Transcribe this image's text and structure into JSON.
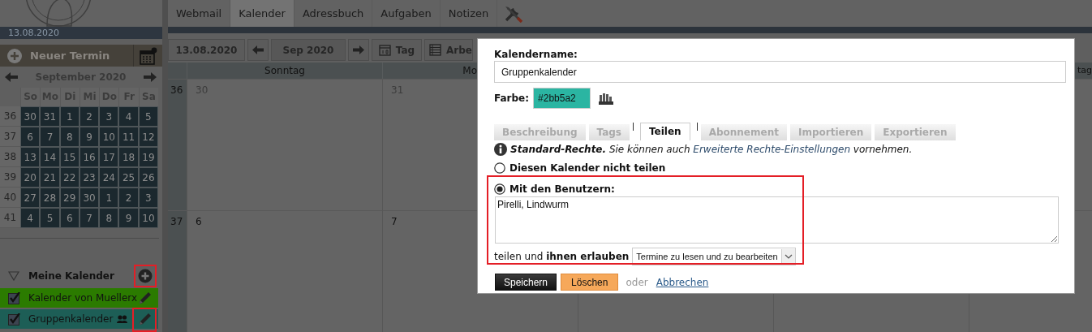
{
  "top_nav": {
    "tabs": [
      {
        "label": "Webmail",
        "selected": false
      },
      {
        "label": "Kalender",
        "selected": true
      },
      {
        "label": "Adressbuch",
        "selected": false
      },
      {
        "label": "Aufgaben",
        "selected": false
      },
      {
        "label": "Notizen",
        "selected": false
      }
    ]
  },
  "sidebar": {
    "date": "13.08.2020",
    "new_event": "Neuer Termin",
    "mini_calendar": {
      "title": "September 2020",
      "weekdays": [
        "So",
        "Mo",
        "Di",
        "Mi",
        "Do",
        "Fr",
        "Sa"
      ],
      "weeks": [
        {
          "number": "36",
          "days": [
            "30",
            "31",
            "1",
            "2",
            "3",
            "4",
            "5"
          ]
        },
        {
          "number": "37",
          "days": [
            "6",
            "7",
            "8",
            "9",
            "10",
            "11",
            "12"
          ]
        },
        {
          "number": "38",
          "days": [
            "13",
            "14",
            "15",
            "16",
            "17",
            "18",
            "19"
          ]
        },
        {
          "number": "39",
          "days": [
            "20",
            "21",
            "22",
            "23",
            "24",
            "25",
            "26"
          ]
        },
        {
          "number": "40",
          "days": [
            "27",
            "28",
            "29",
            "30",
            "1",
            "2",
            "3"
          ]
        },
        {
          "number": "41",
          "days": [
            "4",
            "5",
            "6",
            "7",
            "8",
            "9",
            "10"
          ]
        }
      ]
    },
    "my_calendars": {
      "title": "Meine Kalender",
      "expanded": true,
      "add_highlighted": true,
      "items": [
        {
          "name": "Kalender von Muellerx",
          "checked": true,
          "color": "#2b7b00",
          "shared": false,
          "highlighted": false
        },
        {
          "name": "Gruppenkalender",
          "checked": true,
          "color": "#1d5e56",
          "shared": true,
          "highlighted": true
        }
      ]
    }
  },
  "toolbar": {
    "date": "13.08.2020",
    "period": "Sep 2020",
    "views": [
      "Tag",
      "Arbe"
    ]
  },
  "calendar": {
    "day_columns": [
      {
        "label": "Sonntag"
      },
      {
        "label": "Mo"
      },
      {},
      {},
      {
        "label": "tag"
      }
    ],
    "weeks": [
      {
        "number": "36",
        "days": [
          {
            "label": "30",
            "muted": true
          },
          {
            "label": "31",
            "muted": true
          }
        ]
      },
      {
        "number": "37",
        "days": [
          {
            "label": "6",
            "muted": false
          },
          {
            "label": "7",
            "muted": false
          }
        ]
      }
    ]
  },
  "dialog": {
    "name_label": "Kalendername:",
    "name_value": "Gruppenkalender",
    "color_label": "Farbe:",
    "color_value": "#2bb5a2",
    "tabs": [
      {
        "label": "Beschreibung",
        "selected": false
      },
      {
        "label": "Tags",
        "selected": false
      },
      {
        "label": "Teilen",
        "selected": true
      },
      {
        "label": "Abonnement",
        "selected": false
      },
      {
        "label": "Importieren",
        "selected": false
      },
      {
        "label": "Exportieren",
        "selected": false
      }
    ],
    "info": {
      "before": "**Standard-Rechte.** Sie können auch ",
      "link": "Erweiterte Rechte-Einstellungen",
      "after": " vornehmen."
    },
    "share_options": [
      {
        "label": "Diesen Kalender nicht teilen",
        "selected": false
      },
      {
        "label": "Mit den Benutzern:",
        "selected": true
      }
    ],
    "share_highlighted": true,
    "users": "Pirelli, Lindwurm",
    "permission": {
      "text": "teilen und **ihnen erlauben**",
      "value": "Termine zu lesen und zu bearbeiten"
    },
    "buttons": [
      {
        "label": "Speichern",
        "kind": "primary"
      },
      {
        "label": "Löschen",
        "kind": "danger"
      }
    ],
    "or": "oder",
    "cancel": "Abbrechen"
  }
}
